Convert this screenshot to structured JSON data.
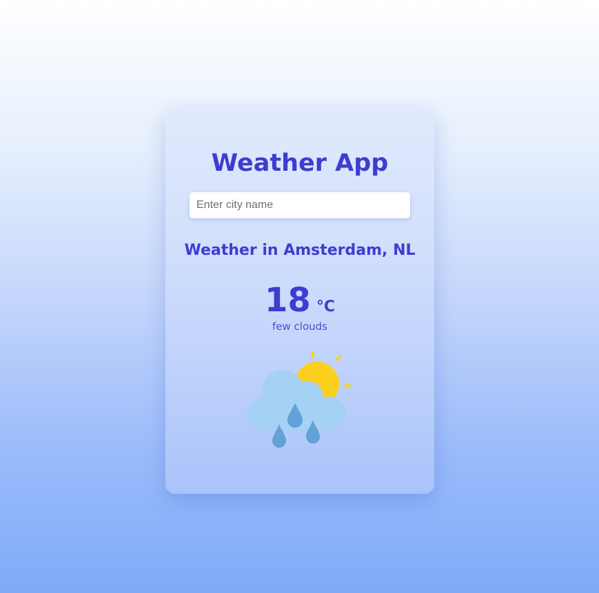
{
  "app": {
    "title": "Weather App"
  },
  "search": {
    "placeholder": "Enter city name",
    "value": ""
  },
  "weather": {
    "location_heading": "Weather in Amsterdam, NL",
    "temperature": "18",
    "unit": "°C",
    "description": "few clouds",
    "icon": "sun-cloud-rain-icon"
  },
  "colors": {
    "accent": "#3d3dcf",
    "sun": "#fcd01f",
    "cloud": "#a5d1f5",
    "raindrop": "#63a1d6"
  }
}
